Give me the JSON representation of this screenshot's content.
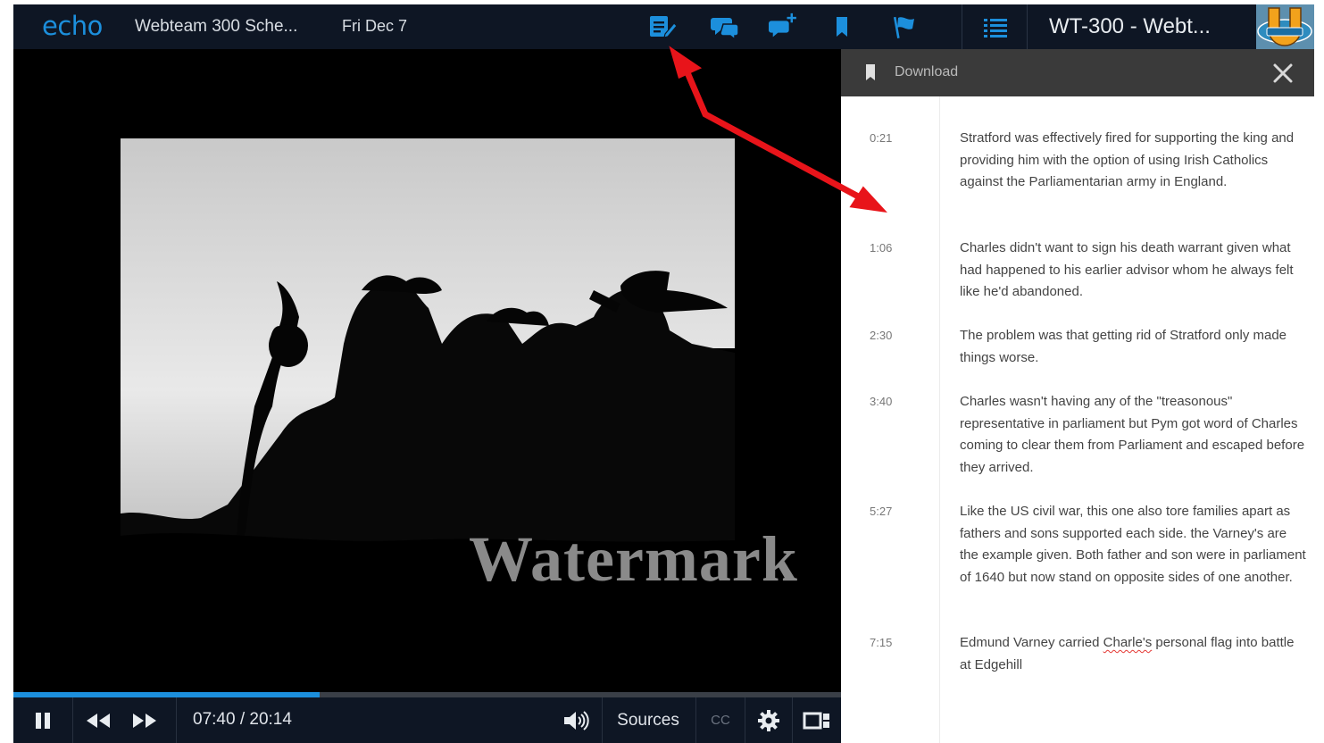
{
  "topbar": {
    "logo": "echo",
    "course": "Webteam 300 Sche...",
    "date": "Fri Dec 7",
    "title": "WT-300 - Webt...",
    "icons": [
      "notes-icon",
      "discussion-icon",
      "add-question-icon",
      "bookmark-icon",
      "flag-icon",
      "list-icon"
    ]
  },
  "video": {
    "watermark": "Watermark",
    "progress": 0.37
  },
  "controls": {
    "time": "07:40 / 20:14",
    "sources": "Sources",
    "cc": "CC"
  },
  "panel": {
    "header_label": "Download",
    "notes": [
      {
        "time": "0:21",
        "text": "Stratford was effectively fired for supporting the king and providing him with the option of using Irish Catholics against the Parliamentarian army in England."
      },
      {
        "time": "1:06",
        "text": "Charles didn't want to sign his death warrant given what had happened to his earlier advisor whom he always felt like he'd abandoned."
      },
      {
        "time": "2:30",
        "text": "The problem was that getting rid of Stratford only made things worse."
      },
      {
        "time": "3:40",
        "text": "Charles wasn't having any of the \"treasonous\" representative in parliament but Pym got word of Charles coming to clear them from Parliament and escaped before they arrived."
      },
      {
        "time": "5:27",
        "text": "Like the US civil war, this one also tore families apart as fathers and sons supported each side. the Varney's are the example given. Both father and son were in parliament of 1640 but now stand on opposite sides of one another."
      },
      {
        "time": "7:15",
        "text_before": "Edmund Varney carried ",
        "text_misspelled": "Charle's",
        "text_after": " personal flag into battle at Edgehill"
      }
    ]
  },
  "colors": {
    "accent": "#1c8fdc",
    "bar": "#0e1624",
    "annotation_arrow": "#e8141a"
  }
}
